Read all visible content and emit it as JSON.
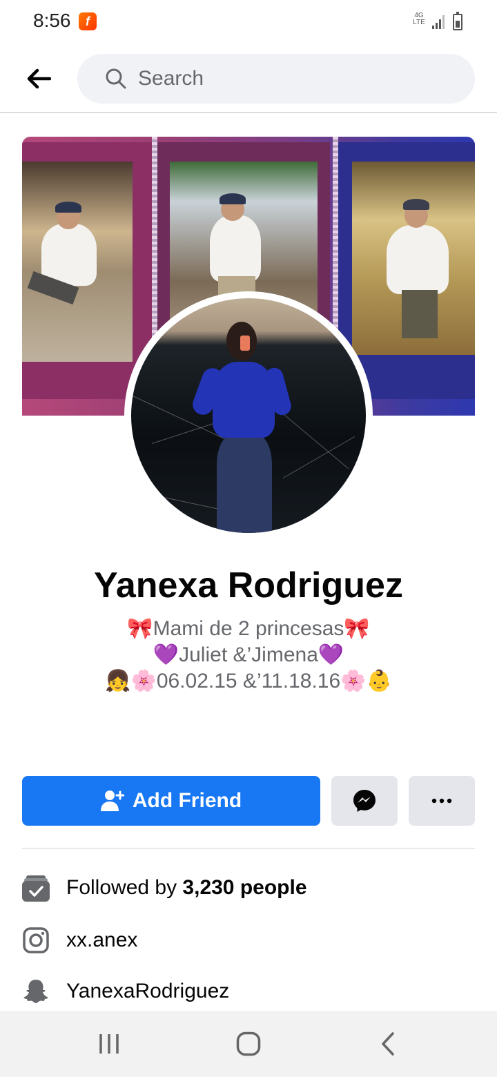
{
  "status_bar": {
    "time": "8:56",
    "app_badge": "f",
    "network": "4G LTE"
  },
  "header": {
    "back_icon": "arrow-left-icon",
    "search_placeholder": "Search"
  },
  "profile": {
    "name": "Yanexa Rodriguez",
    "bio_lines": [
      "🎀Mami de 2 princesas🎀",
      "💜Juliet &’Jimena💜",
      "👧🌸06.02.15 &’11.18.16🌸👶"
    ]
  },
  "actions": {
    "add_friend_label": "Add Friend",
    "add_friend_icon": "add-person-icon",
    "messenger_icon": "messenger-icon",
    "more_icon": "more-horizontal-icon",
    "accent_color": "#1877f2"
  },
  "details": {
    "followers_prefix": "Followed by ",
    "followers_count": "3,230 people",
    "instagram": "xx.anex",
    "snapchat": "YanexaRodriguez"
  },
  "nav": {
    "recents_icon": "recent-apps-icon",
    "home_icon": "home-icon",
    "back_icon": "back-chevron-icon"
  }
}
